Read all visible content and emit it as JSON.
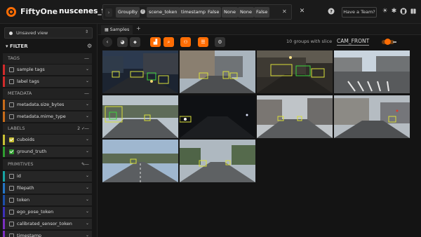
{
  "app": {
    "title": "FiftyOne",
    "dataset": "nuscenes_final"
  },
  "stage": {
    "name": "GroupBy",
    "fields": [
      "scene_token",
      "timestamp",
      "False",
      "None",
      "None",
      "False"
    ]
  },
  "header": {
    "team_button": "Have a Team?"
  },
  "sidebar": {
    "view_select": "Unsaved view",
    "filter_title": "FILTER",
    "sections": {
      "tags": "TAGS",
      "metadata": "METADATA",
      "labels": "LABELS",
      "labels_count": "2",
      "primitives": "PRIMITIVES"
    },
    "tags": [
      "sample tags",
      "label tags"
    ],
    "metadata": [
      "metadata.size_bytes",
      "metadata.mime_type"
    ],
    "labels": [
      "cuboids",
      "ground_truth"
    ],
    "primitives": [
      "id",
      "filepath",
      "token",
      "ego_pose_token",
      "calibrated_sensor_token",
      "timestamp"
    ]
  },
  "tabs": {
    "samples": "Samples"
  },
  "toolbar": {
    "group_count": "10 groups with slice",
    "slice": "CAM_FRONT"
  },
  "colors": {
    "accent": "#ff6d04",
    "tags_bar": [
      "#d12a2a",
      "#d12a2a"
    ],
    "metadata_bar": [
      "#c76b1a",
      "#c76b1a"
    ],
    "labels_bar": [
      "#c9c034",
      "#2f9c2f"
    ],
    "primitives_bar": [
      "#18a4a4",
      "#2576c6",
      "#1c4ea8",
      "#3c2fb8",
      "#7a2fbf",
      "#7a2fbf"
    ]
  },
  "samples": [
    {
      "scene": "city-night-boxes"
    },
    {
      "scene": "street-buildings"
    },
    {
      "scene": "dusk-construction"
    },
    {
      "scene": "crosswalk-day"
    },
    {
      "scene": "cloudy-road-boxes"
    },
    {
      "scene": "night-road"
    },
    {
      "scene": "overcast-street"
    },
    {
      "scene": "downtown-overcast"
    },
    {
      "scene": "suburban-road"
    },
    {
      "scene": "treelined-road"
    }
  ]
}
